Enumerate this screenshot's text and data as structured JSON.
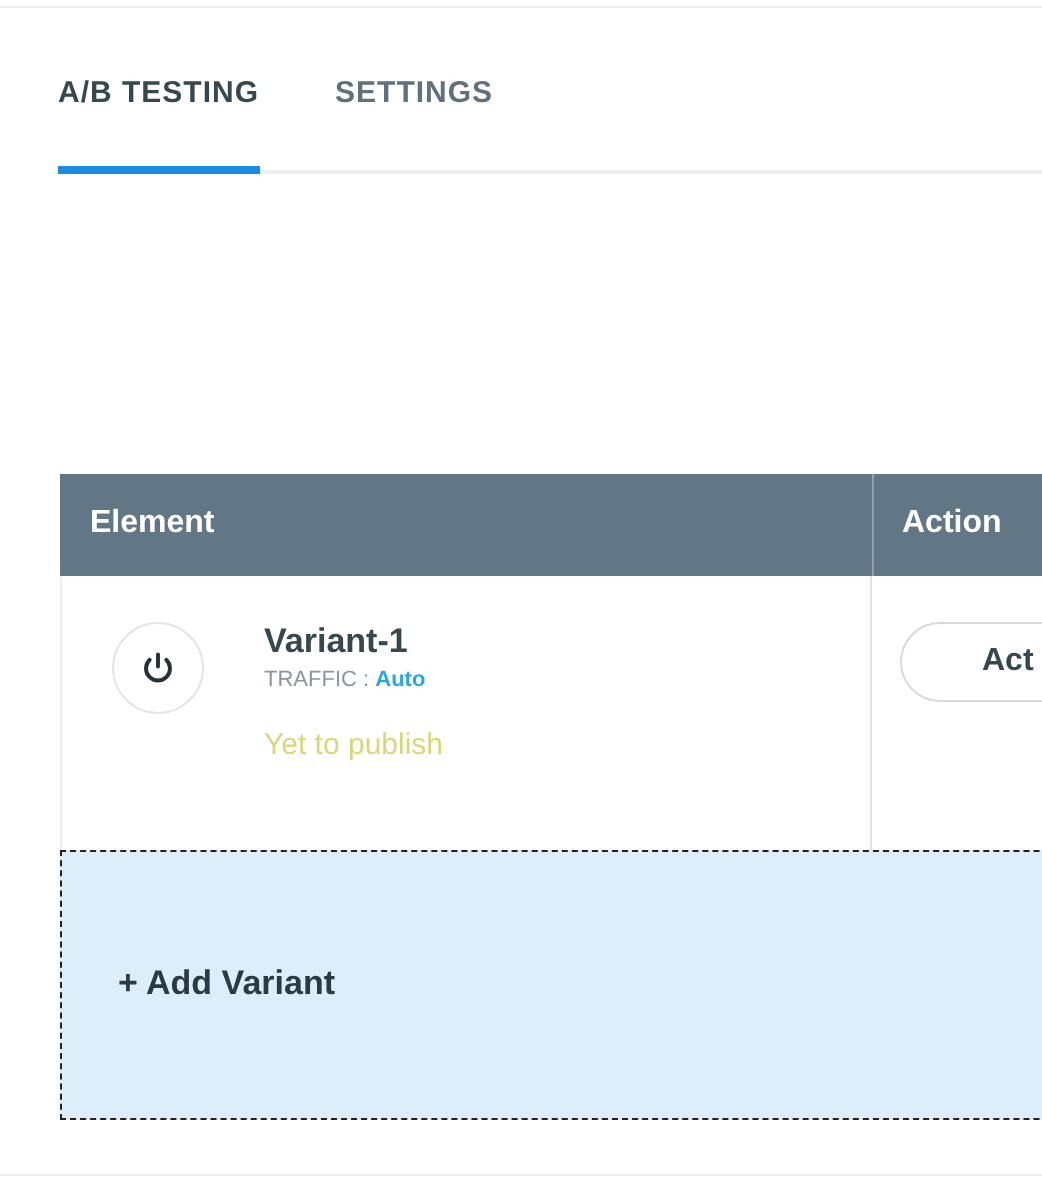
{
  "tabs": [
    {
      "label": "A/B TESTING",
      "selected": true
    },
    {
      "label": "SETTINGS",
      "selected": false
    }
  ],
  "table": {
    "columns": [
      "Element",
      "Action"
    ],
    "rows": [
      {
        "name": "Variant-1",
        "traffic_label": "TRAFFIC :",
        "traffic_value": "Auto",
        "status": "Yet to publish",
        "action": "Act"
      }
    ]
  },
  "add_variant": "+ Add Variant"
}
